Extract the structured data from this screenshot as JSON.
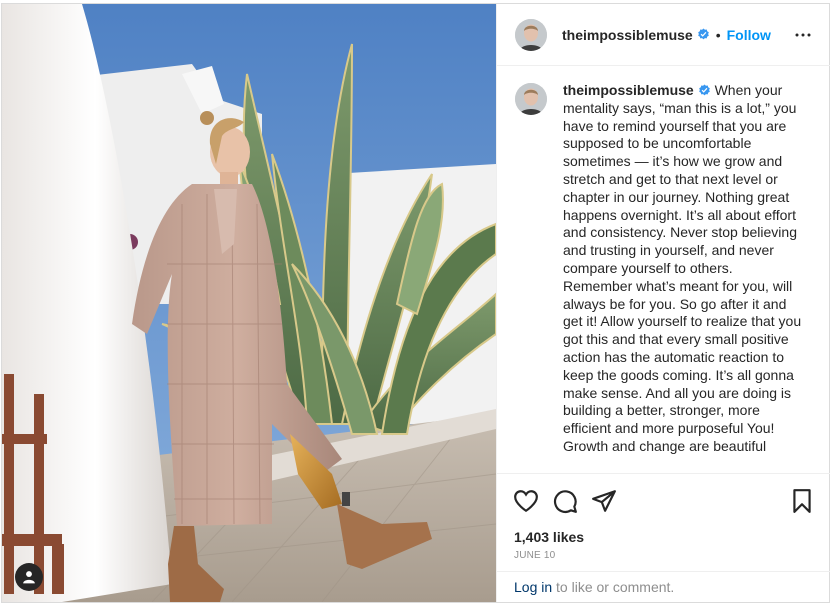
{
  "post": {
    "username": "theimpossiblemuse",
    "verified": true,
    "separator": "•",
    "follow_label": "Follow",
    "more_icon": "more-horizontal-icon",
    "photo_alt": "woman in plaid coat beside agave plant",
    "caption": "When your mentality says, “man this is a lot,” you have to remind yourself that you are supposed to be uncomfortable sometimes — it’s how we grow and stretch and get to that next level or chapter in our journey. Nothing great happens overnight. It’s all about effort and consistency. Never stop believing and trusting in yourself, and never compare yourself to others. Remember what’s meant for you, will always be for you. So go after it and get it! Allow yourself to realize that you got this and that every small positive action has the automatic reaction to keep the goods coming. It’s all gonna make sense. And all you are doing is building a better, stronger, more efficient and more purposeful You! Growth and change are beautiful",
    "likes": "1,403 likes",
    "date": "JUNE 10",
    "login_link": "Log in",
    "login_rest": " to like or comment."
  },
  "icons": {
    "like": "heart-icon",
    "comment": "comment-icon",
    "share": "share-icon",
    "save": "bookmark-icon",
    "tag": "user-tag-icon",
    "verified": "verified-badge-icon"
  },
  "colors": {
    "accent": "#0095f6",
    "verified": "#3897f0",
    "text": "#262626",
    "muted": "#8e8e8e",
    "link": "#00376b",
    "border": "#efefef"
  }
}
